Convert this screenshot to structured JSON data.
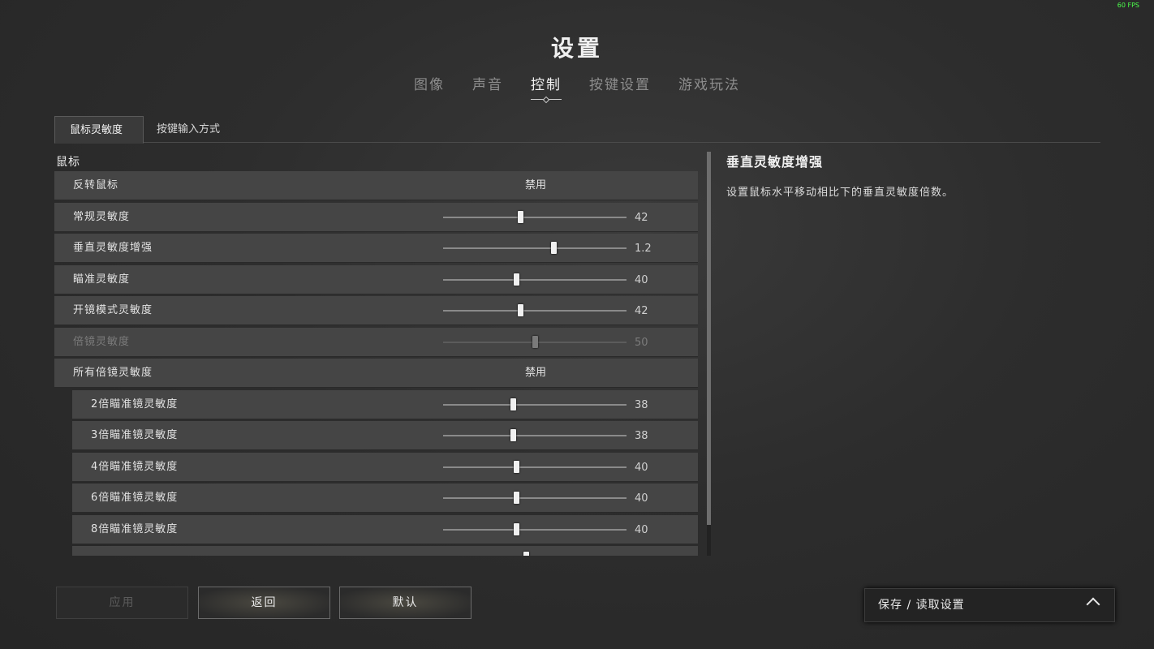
{
  "fps": "60 FPS",
  "title": "设置",
  "tabs": [
    {
      "label": "图像"
    },
    {
      "label": "声音"
    },
    {
      "label": "控制"
    },
    {
      "label": "按键设置"
    },
    {
      "label": "游戏玩法"
    }
  ],
  "active_tab": "控制",
  "subtabs": [
    {
      "label": "鼠标灵敏度"
    },
    {
      "label": "按键输入方式"
    }
  ],
  "section_label": "鼠标",
  "rows": [
    {
      "label": "反转鼠标",
      "text": "禁用"
    },
    {
      "label": "常规灵敏度",
      "value": "42",
      "level": 0.42
    },
    {
      "label": "垂直灵敏度增强",
      "value": "1.2",
      "level": 0.6
    },
    {
      "label": "瞄准灵敏度",
      "value": "40",
      "level": 0.4
    },
    {
      "label": "开镜模式灵敏度",
      "value": "42",
      "level": 0.42
    },
    {
      "label": "倍镜灵敏度",
      "value": "50",
      "level": 0.5,
      "disabled": true
    },
    {
      "label": "所有倍镜灵敏度",
      "text": "禁用"
    },
    {
      "label": "2倍瞄准镜灵敏度",
      "value": "38",
      "level": 0.38
    },
    {
      "label": "3倍瞄准镜灵敏度",
      "value": "38",
      "level": 0.38
    },
    {
      "label": "4倍瞄准镜灵敏度",
      "value": "40",
      "level": 0.4
    },
    {
      "label": "6倍瞄准镜灵敏度",
      "value": "40",
      "level": 0.4
    },
    {
      "label": "8倍瞄准镜灵敏度",
      "value": "40",
      "level": 0.4
    }
  ],
  "info": {
    "title": "垂直灵敏度增强",
    "description": "设置鼠标水平移动相比下的垂直灵敏度倍数。"
  },
  "buttons": {
    "apply": "应用",
    "back": "返回",
    "default": "默认"
  },
  "saveload_label": "保存 / 读取设置"
}
